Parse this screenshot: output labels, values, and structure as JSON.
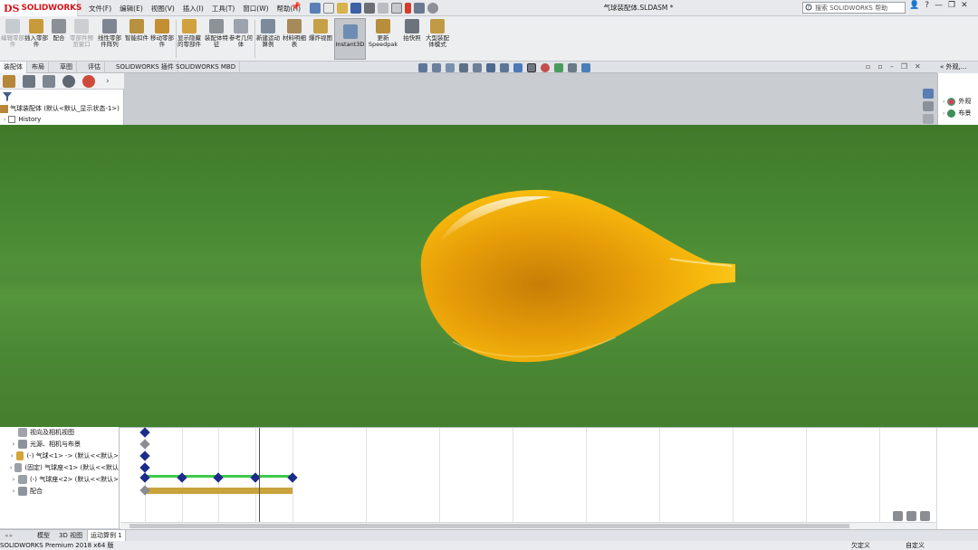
{
  "app": {
    "logo_ds": "DS",
    "logo_brand": "SOLIDWORKS",
    "document_title": "气球装配体.SLDASM *"
  },
  "menu": [
    "文件(F)",
    "编辑(E)",
    "视图(V)",
    "插入(I)",
    "工具(T)",
    "窗口(W)",
    "帮助(H)"
  ],
  "search": {
    "placeholder": "搜索 SOLIDWORKS 帮助"
  },
  "window_controls": [
    "?",
    "—",
    "❐",
    "✕"
  ],
  "commands": [
    {
      "label": "编辑零部件",
      "enabled": false
    },
    {
      "label": "插入零部件",
      "enabled": true
    },
    {
      "label": "配合",
      "enabled": true
    },
    {
      "label": "零部件预览窗口",
      "enabled": false
    },
    {
      "label": "线性零部件阵列",
      "enabled": true
    },
    {
      "label": "智能扣件",
      "enabled": true
    },
    {
      "label": "移动零部件",
      "enabled": true
    },
    {
      "label": "显示隐藏的零部件",
      "enabled": true
    },
    {
      "label": "装配体特征",
      "enabled": true
    },
    {
      "label": "参考几何体",
      "enabled": true
    },
    {
      "label": "新建运动算例",
      "enabled": true
    },
    {
      "label": "材料明细表",
      "enabled": true
    },
    {
      "label": "爆炸视图",
      "enabled": true
    },
    {
      "label": "Instant3D",
      "enabled": true
    },
    {
      "label": "更新Speedpak",
      "enabled": true
    },
    {
      "label": "拍快照",
      "enabled": true
    },
    {
      "label": "大型装配体模式",
      "enabled": true
    }
  ],
  "tabs": [
    "装配体",
    "布局",
    "草图",
    "评估",
    "SOLIDWORKS 插件",
    "SOLIDWORKS MBD"
  ],
  "active_tab": "装配体",
  "feature_tree": {
    "root": "气球装配体 (默认<默认_显示状态-1>)",
    "history": "History"
  },
  "task_pane": {
    "header": "外观,...",
    "items": [
      "外观",
      "布景"
    ]
  },
  "motion_study": {
    "rows": [
      {
        "label": "视向及相机视图",
        "icon": "camera-icon"
      },
      {
        "label": "光源、相机与布景",
        "icon": "lights-icon"
      },
      {
        "label": "(-) 气球<1> -> (默认<<默认>",
        "icon": "part-icon"
      },
      {
        "label": "(固定) 气球座<1> (默认<<默认",
        "icon": "part-icon"
      },
      {
        "label": "(-) 气球座<2> (默认<<默认>",
        "icon": "part-icon"
      },
      {
        "label": "配合",
        "icon": "mates-icon"
      }
    ]
  },
  "bottom_tabs": [
    "模型",
    "3D 视图",
    "运动算例 1"
  ],
  "active_bottom_tab": "运动算例 1",
  "status": {
    "left": "SOLIDWORKS Premium 2018 x64 版",
    "mid1": "欠定义",
    "mid2": "自定义"
  },
  "colors": {
    "background_green": "#4a8a33",
    "balloon_yellow": "#f5b50a",
    "key_blue": "#1b2c8a",
    "bar_green": "#3fc94a",
    "bar_gold": "#c9a33b",
    "brand_red": "#d2161d"
  }
}
